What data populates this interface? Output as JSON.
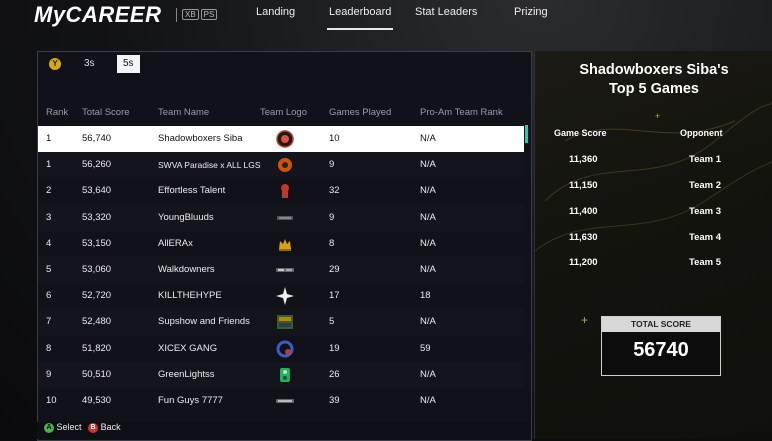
{
  "header": {
    "logo": "MyCAREER",
    "platform_badges": [
      "XB",
      "PS"
    ],
    "nav": [
      "Landing",
      "Leaderboard",
      "Stat Leaders",
      "Prizing"
    ],
    "active_nav": "Leaderboard"
  },
  "leaderboard": {
    "y_button": "Y",
    "tabs": [
      "3s",
      "5s"
    ],
    "active_tab": "5s",
    "columns": [
      "Rank",
      "Total Score",
      "Team Name",
      "Team Logo",
      "Games Played",
      "Pro-Am Team Rank"
    ],
    "rows": [
      {
        "rank": "1",
        "score": "56,740",
        "team": "Shadowboxers Siba",
        "games": "10",
        "proam": "N/A",
        "logo": "shadowboxers-logo"
      },
      {
        "rank": "1",
        "score": "56,260",
        "team": "SWVA Paradise x ALL LGS",
        "games": "9",
        "proam": "N/A",
        "logo": "swva-logo"
      },
      {
        "rank": "2",
        "score": "53,640",
        "team": "Effortless Talent",
        "games": "32",
        "proam": "N/A",
        "logo": "effortless-logo"
      },
      {
        "rank": "3",
        "score": "53,320",
        "team": "YoungBluuds",
        "games": "9",
        "proam": "N/A",
        "logo": "youngbluuds-logo"
      },
      {
        "rank": "4",
        "score": "53,150",
        "team": "AllERAx",
        "games": "8",
        "proam": "N/A",
        "logo": "allerax-logo"
      },
      {
        "rank": "5",
        "score": "53,060",
        "team": "Walkdowners",
        "games": "29",
        "proam": "N/A",
        "logo": "walkdowners-logo"
      },
      {
        "rank": "6",
        "score": "52,720",
        "team": "KILLTHEHYPE",
        "games": "17",
        "proam": "18",
        "logo": "killthehype-logo"
      },
      {
        "rank": "7",
        "score": "52,480",
        "team": "Supshow and Friends",
        "games": "5",
        "proam": "N/A",
        "logo": "supshow-logo"
      },
      {
        "rank": "8",
        "score": "51,820",
        "team": "XICEX GANG",
        "games": "19",
        "proam": "59",
        "logo": "xicex-logo"
      },
      {
        "rank": "9",
        "score": "50,510",
        "team": "GreenLightss",
        "games": "26",
        "proam": "N/A",
        "logo": "greenlightss-logo"
      },
      {
        "rank": "10",
        "score": "49,530",
        "team": "Fun Guys 7777",
        "games": "39",
        "proam": "N/A",
        "logo": "funguys-logo"
      }
    ]
  },
  "top_games": {
    "title_line1": "Shadowboxers Siba's",
    "title_line2": "Top 5 Games",
    "col_score": "Game Score",
    "col_opponent": "Opponent",
    "games": [
      {
        "score": "11,360",
        "opponent": "Team 1"
      },
      {
        "score": "11,150",
        "opponent": "Team 2"
      },
      {
        "score": "11,400",
        "opponent": "Team 3"
      },
      {
        "score": "11,630",
        "opponent": "Team 4"
      },
      {
        "score": "11,200",
        "opponent": "Team 5"
      }
    ],
    "total_label": "TOTAL SCORE",
    "total_value": "56740"
  },
  "hints": {
    "a_button": "A",
    "a_label": "Select",
    "b_button": "B",
    "b_label": "Back"
  },
  "colors": {
    "accent_teal": "#2ec7b2",
    "y_button": "#d8a814",
    "a_button": "#4caf50",
    "b_button": "#d32f2f",
    "gold_texture": "#bfa84a"
  }
}
